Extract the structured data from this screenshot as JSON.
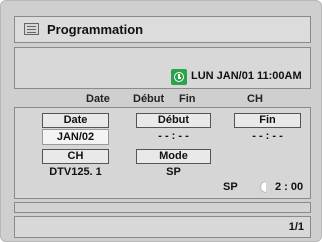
{
  "window": {
    "title": "Programmation",
    "title_icon": "menu-list-icon"
  },
  "clock": {
    "icon": "clock-icon",
    "datetime": "LUN JAN/01 11:00AM"
  },
  "columns": [
    "Date",
    "Début",
    "Fin",
    "CH"
  ],
  "form": {
    "date_label": "Date",
    "date_value": "JAN/02",
    "start_label": "Début",
    "start_value": "- - : - -",
    "end_label": "Fin",
    "end_value": "- - : - -",
    "ch_label": "CH",
    "ch_value": "DTV125. 1",
    "mode_label": "Mode",
    "mode_value": "SP"
  },
  "recording_time": {
    "mode": "SP",
    "icon": "half-moon-icon",
    "duration": "2 : 00"
  },
  "footer": {
    "page_indicator": "1/1"
  }
}
